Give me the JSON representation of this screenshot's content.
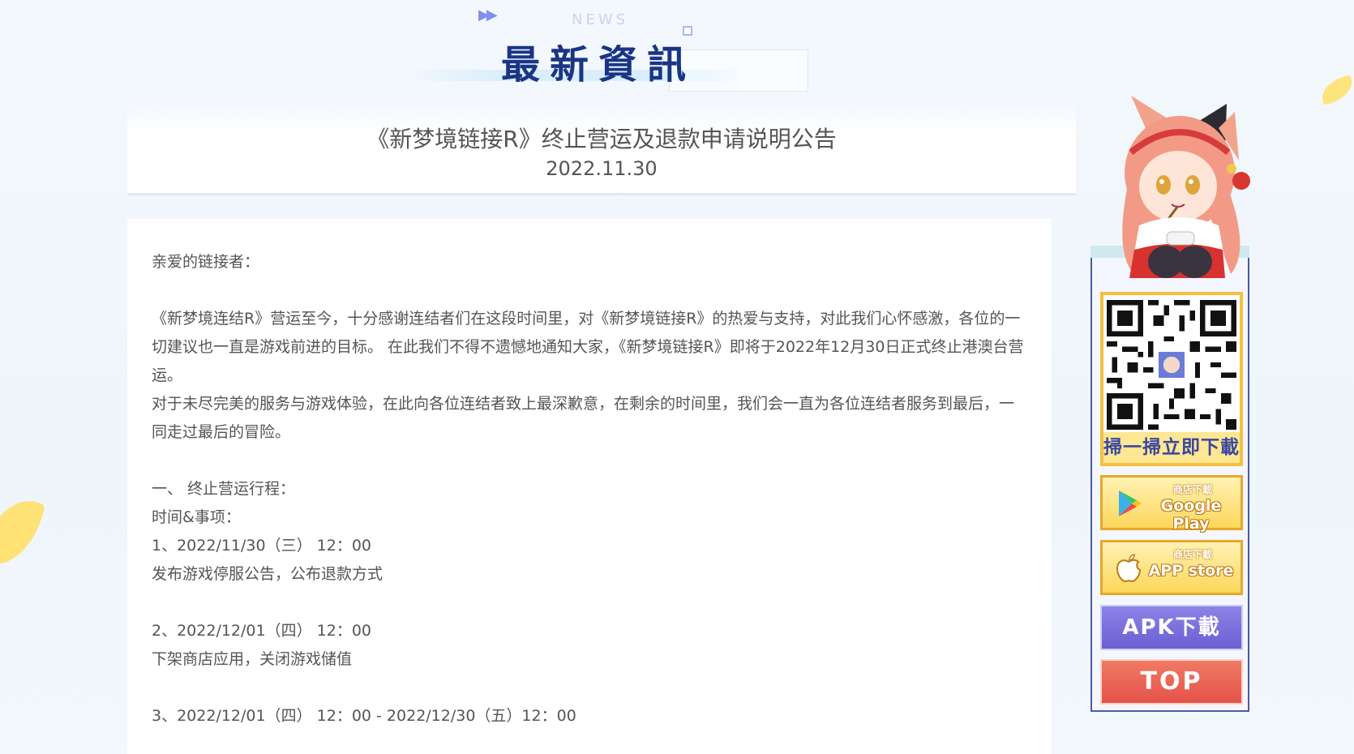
{
  "header": {
    "play_glyph": "▶▶",
    "news_label": "NEWS",
    "section_title": "最新資訊"
  },
  "article": {
    "title": "《新梦境链接R》终止营运及退款申请说明公告",
    "date": "2022.11.30",
    "paragraphs": [
      "亲爱的链接者：",
      "",
      "《新梦境连结R》营运至今，十分感谢连结者们在这段时间里，对《新梦境链接R》的热爱与支持，对此我们心怀感激，各位的一切建议也一直是游戏前进的目标。 在此我们不得不遗憾地通知大家，《新梦境链接R》即将于2022年12月30日正式终止港澳台营运。",
      "对于未尽完美的服务与游戏体验，在此向各位连结者致上最深歉意，在剩余的时间里，我们会一直为各位连结者服务到最后，一同走过最后的冒险。",
      "",
      "一、 终止营运行程：",
      "时间&事项：",
      "1、2022/11/30（三） 12：00",
      "发布游戏停服公告，公布退款方式",
      "",
      "2、2022/12/01（四） 12：00",
      "下架商店应用，关闭游戏储值",
      "",
      "3、2022/12/01（四） 12：00 - 2022/12/30（五）12：00"
    ]
  },
  "sidebar": {
    "qr_caption": "掃一掃立即下載",
    "google_play": {
      "small": "商店下載",
      "big": "Google Play"
    },
    "app_store": {
      "small": "商店下載",
      "big": "APP store"
    },
    "apk_label": "APK下載",
    "top_label": "TOP"
  },
  "colors": {
    "title_navy": "#1a3585",
    "frame_blue": "#4b58a8",
    "gold": "#f5c040",
    "apk_purple": "#7a6fdd",
    "top_red": "#e75a4f"
  }
}
